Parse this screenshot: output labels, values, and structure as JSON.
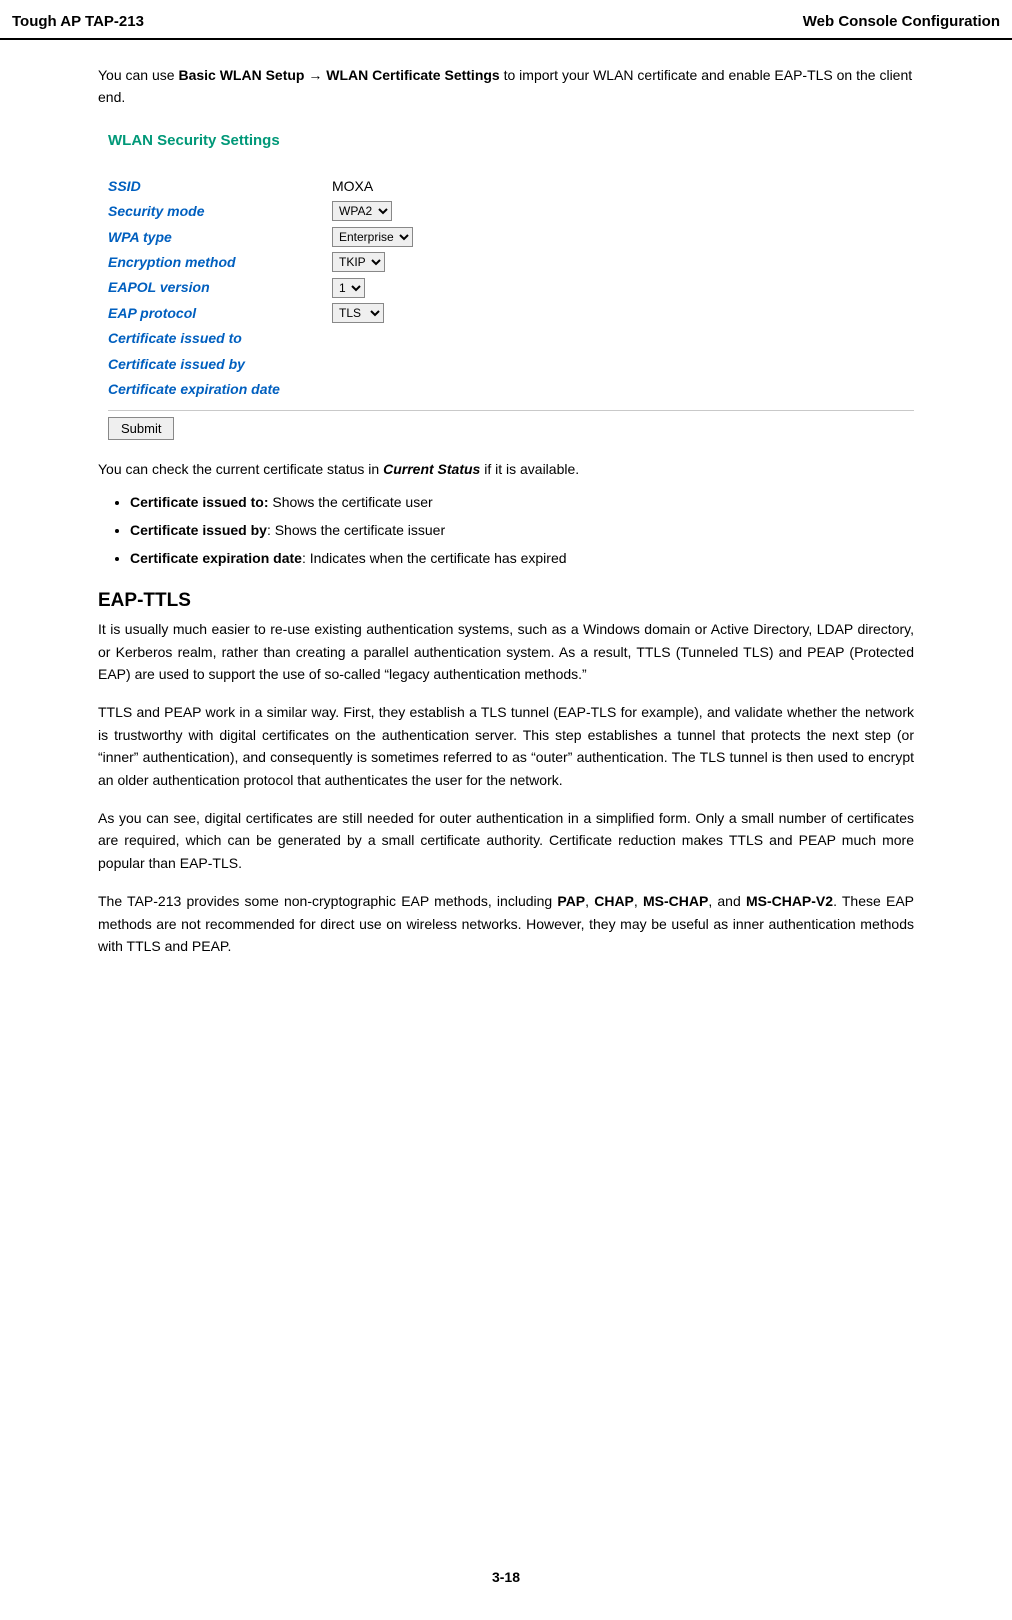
{
  "header": {
    "left": "Tough AP TAP-213",
    "right": "Web Console Configuration"
  },
  "intro": {
    "prefix": "You can use ",
    "bold1": "Basic WLAN Setup ",
    "arrow": "→",
    "bold2": " WLAN Certificate Settings",
    "suffix": " to import your WLAN certificate and enable EAP-TLS on the client end."
  },
  "screenshot": {
    "title": "WLAN Security Settings",
    "rows": {
      "ssid": {
        "label": "SSID",
        "value": "MOXA"
      },
      "secmode": {
        "label": "Security mode",
        "value": "WPA2"
      },
      "wpatype": {
        "label": "WPA type",
        "value": "Enterprise"
      },
      "enc": {
        "label": "Encryption method",
        "value": "TKIP"
      },
      "eapol": {
        "label": "EAPOL version",
        "value": "1"
      },
      "eapproto": {
        "label": "EAP protocol",
        "value": "TLS"
      },
      "certto": {
        "label": "Certificate issued to"
      },
      "certby": {
        "label": "Certificate issued by"
      },
      "certexp": {
        "label": "Certificate expiration date"
      }
    },
    "submit": "Submit"
  },
  "status_line": {
    "prefix": "You can check the current certificate status in ",
    "bi": "Current Status",
    "suffix": " if it is available."
  },
  "cert_items": [
    {
      "bold": "Certificate issued to:",
      "rest": " Shows the certificate user"
    },
    {
      "bold": "Certificate issued by",
      "rest": ": Shows the certificate issuer"
    },
    {
      "bold": "Certificate expiration date",
      "rest": ": Indicates when the certificate has expired"
    }
  ],
  "section": {
    "heading": "EAP-TTLS",
    "p1": "It is usually much easier to re-use existing authentication systems, such as a Windows domain or Active Directory, LDAP directory, or Kerberos realm, rather than creating a parallel authentication system. As a result, TTLS (Tunneled TLS) and PEAP (Protected EAP) are used to support the use of so-called “legacy authentication methods.”",
    "p2": "TTLS and PEAP work in a similar way. First, they establish a TLS tunnel (EAP-TLS for example), and validate whether the network is trustworthy with digital certificates on the authentication server. This step establishes a tunnel that protects the next step (or “inner” authentication), and consequently is sometimes referred to as “outer” authentication. The TLS tunnel is then used to encrypt an older authentication protocol that authenticates the user for the network.",
    "p3": "As you can see, digital certificates are still needed for outer authentication in a simplified form. Only a small number of certificates are required, which can be generated by a small certificate authority. Certificate reduction makes TTLS and PEAP much more popular than EAP-TLS.",
    "p4_1": "The TAP-213 provides some non-cryptographic EAP methods, including ",
    "p4_b1": "PAP",
    "p4_s1": ", ",
    "p4_b2": "CHAP",
    "p4_s2": ", ",
    "p4_b3": "MS-CHAP",
    "p4_s3": ", and ",
    "p4_b4": "MS-CHAP-V2",
    "p4_2": ". These EAP methods are not recommended for direct use on wireless networks. However, they may be useful as inner authentication methods with TTLS and PEAP."
  },
  "footer": "3-18"
}
